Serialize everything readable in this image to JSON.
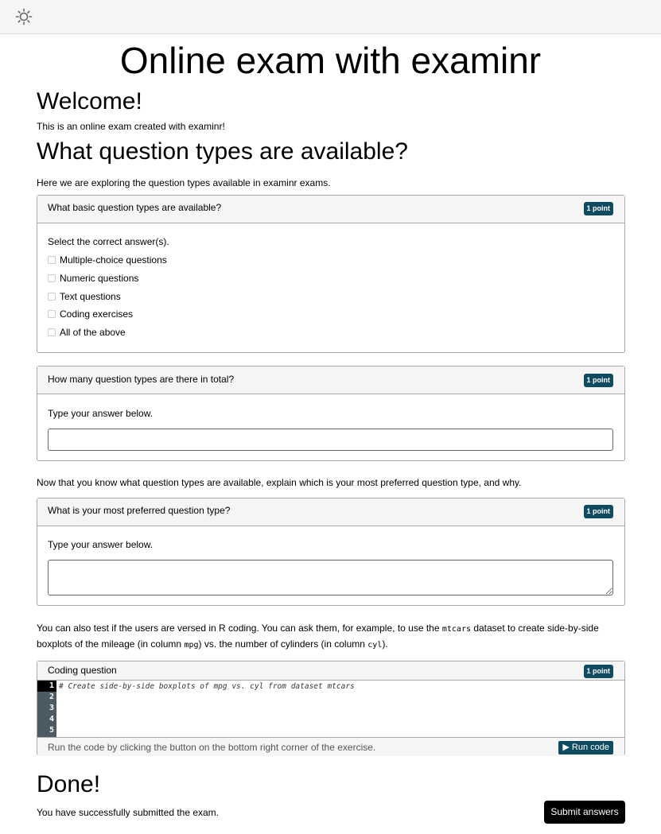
{
  "header": {
    "theme_icon": "sun-icon"
  },
  "title": "Online exam with examinr",
  "welcome": {
    "heading": "Welcome!",
    "text": "This is an online exam created with examinr!"
  },
  "types_section": {
    "heading": "What question types are available?",
    "intro": "Here we are exploring the question types available in examinr exams."
  },
  "q1": {
    "question": "What basic question types are available?",
    "points": "1 point",
    "instruction": "Select the correct answer(s).",
    "options": [
      "Multiple-choice questions",
      "Numeric questions",
      "Text questions",
      "Coding exercises",
      "All of the above"
    ]
  },
  "q2": {
    "question": "How many question types are there in total?",
    "points": "1 point",
    "instruction": "Type your answer below.",
    "value": ""
  },
  "between_text": "Now that you know what question types are available, explain which is your most preferred question type, and why.",
  "q3": {
    "question": "What is your most preferred question type?",
    "points": "1 point",
    "instruction": "Type your answer below.",
    "value": ""
  },
  "coding_intro": {
    "part1": "You can also test if the users are versed in R coding. You can ask them, for example, to use the ",
    "code1": "mtcars",
    "part2": " dataset to create side-by-side",
    "part3": "boxplots of the mileage (in column ",
    "code2": "mpg",
    "part4": ") vs. the number of cylinders (in column ",
    "code3": "cyl",
    "part5": ")."
  },
  "q4": {
    "question": "Coding question",
    "points": "1 point",
    "line_numbers": [
      "1",
      "2",
      "3",
      "4",
      "5"
    ],
    "code": "# Create side-by-side boxplots of mpg vs. cyl from dataset mtcars",
    "footer": "Run the code by clicking the button on the bottom right corner of the exercise.",
    "run_label": "Run code"
  },
  "done": {
    "heading": "Done!",
    "text": "You have successfully submitted the exam."
  },
  "submit_label": "Submit answers",
  "colors": {
    "badge": "#0f4a63",
    "submit": "#000000"
  }
}
